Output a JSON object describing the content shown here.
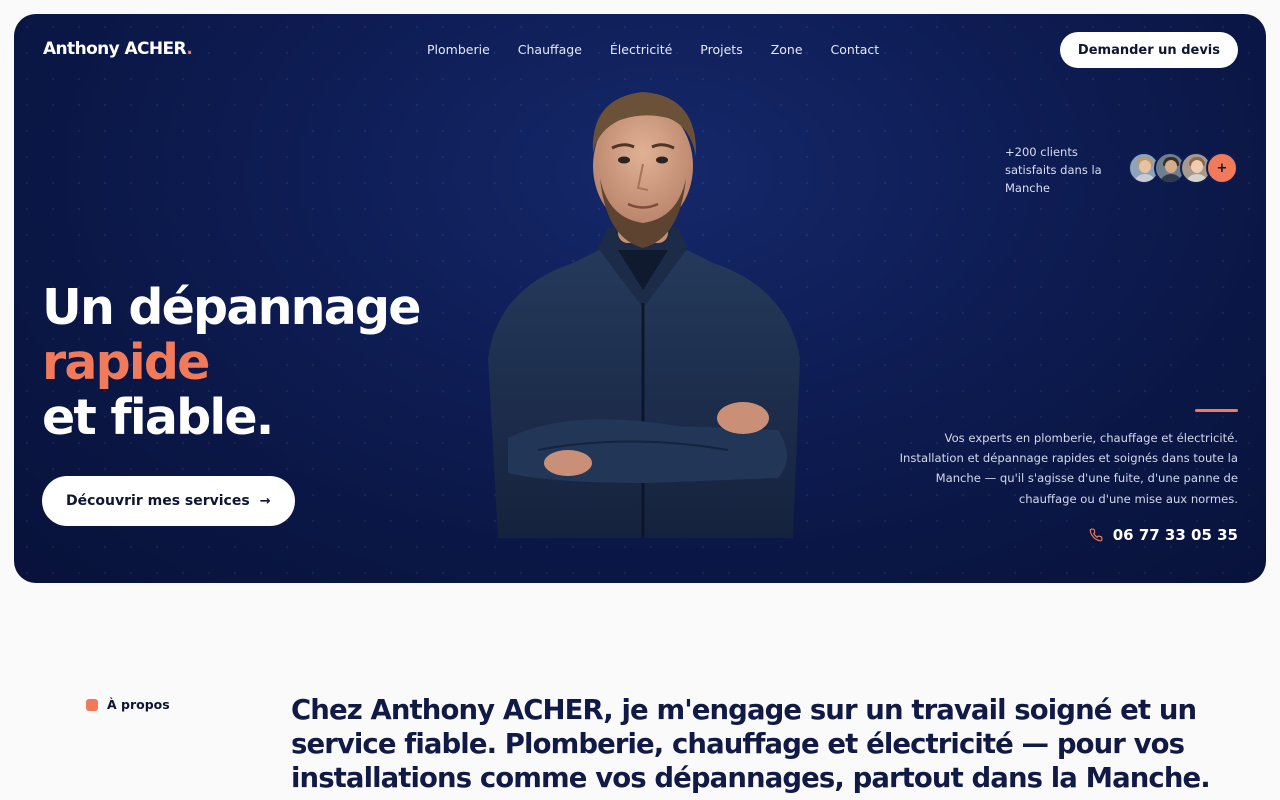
{
  "brand": {
    "name": "Anthony ACHER",
    "dot": ".",
    "accent_color": "#f07a5a",
    "navy": "#0a1644"
  },
  "nav": {
    "items": [
      {
        "label": "Plomberie"
      },
      {
        "label": "Chauffage"
      },
      {
        "label": "Électricité"
      },
      {
        "label": "Projets"
      },
      {
        "label": "Zone"
      },
      {
        "label": "Contact"
      }
    ],
    "cta_label": "Demander un devis"
  },
  "hero": {
    "headline_line1": "Un dépannage",
    "headline_accent": "rapide",
    "headline_line3": "et fiable.",
    "cta_label": "Découvrir mes services",
    "cta_icon": "arrow-right-icon",
    "clients_text": "+200 clients satisfaits dans la Manche",
    "clients_more": "+",
    "description": "Vos experts en plomberie, chauffage et électricité. Installation et dépannage rapides et soignés dans toute la Manche — qu'il s'agisse d'une fuite, d'une panne de chauffage ou d'une mise aux normes.",
    "phone": "06 77 33 05 35",
    "phone_icon": "phone-icon"
  },
  "about": {
    "tag": "À propos",
    "text": "Chez Anthony ACHER, je m'engage sur un travail soigné et un service fiable. Plomberie, chauffage et électricité — pour vos installations comme vos dépannages, partout dans la Manche."
  }
}
